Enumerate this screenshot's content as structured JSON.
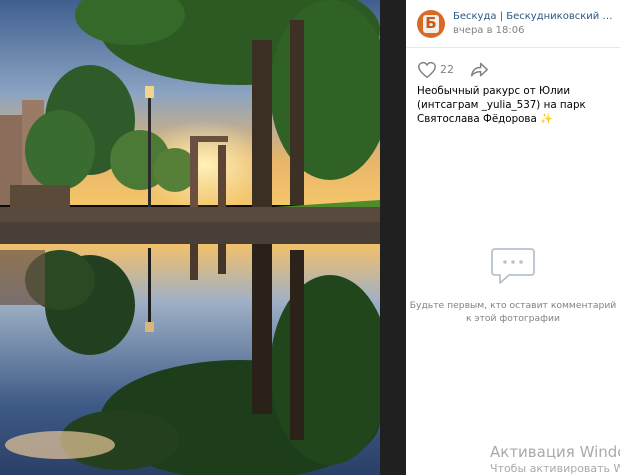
{
  "post": {
    "author": "Бескуда | Бескудниковский район ...",
    "time": "вчера в 18:06",
    "likes": "22",
    "caption": "Необычный ракурс от Юлии (интсаграм _yulia_537) на парк Святослава Фёдорова",
    "caption_emoji": "✨"
  },
  "comments": {
    "empty_text": "Будьте первым, кто оставит комментарий к этой фотографии"
  },
  "watermark": {
    "line1": "Активация Windo",
    "line2": "Чтобы активировать W"
  },
  "icons": [
    "heart-icon",
    "share-arrow-icon",
    "comment-bubble-icon"
  ],
  "colors": {
    "link": "#2a5885",
    "muted": "#828282",
    "avatar": "#d86a27"
  }
}
